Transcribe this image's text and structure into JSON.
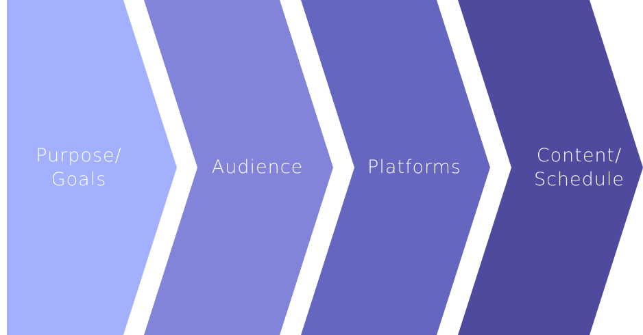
{
  "process_flow": {
    "steps": [
      {
        "label": "Purpose/\nGoals",
        "color": "#a3b0fd"
      },
      {
        "label": "Audience",
        "color": "#8184d8"
      },
      {
        "label": "Platforms",
        "color": "#6566c0"
      },
      {
        "label": "Content/\nSchedule",
        "color": "#4e4a9e"
      }
    ]
  }
}
